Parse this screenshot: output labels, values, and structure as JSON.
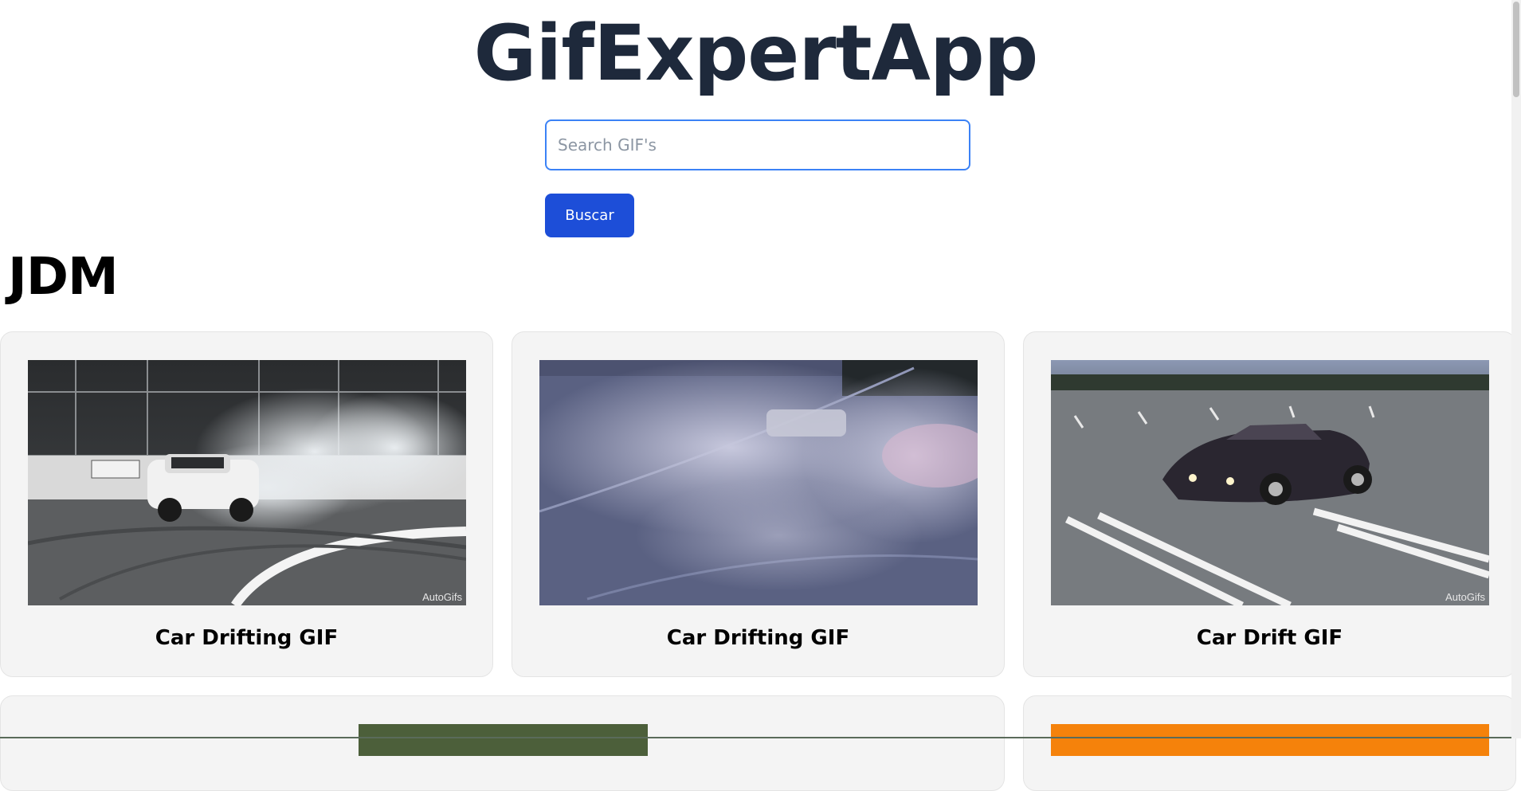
{
  "app": {
    "title": "GifExpertApp"
  },
  "search": {
    "placeholder": "Search GIF's",
    "value": "",
    "button_label": "Buscar"
  },
  "category": {
    "title": "JDM",
    "gifs": [
      {
        "title": "Car Drifting GIF",
        "watermark": "AutoGifs"
      },
      {
        "title": "Car Drifting GIF",
        "watermark": ""
      },
      {
        "title": "Car Drift GIF",
        "watermark": "AutoGifs"
      }
    ]
  },
  "colors": {
    "accent": "#1d4ed8",
    "input_border": "#3b82f6",
    "title": "#1e293b",
    "card_bg": "#f4f4f4",
    "partial_gif_orange": "#f5820b"
  }
}
